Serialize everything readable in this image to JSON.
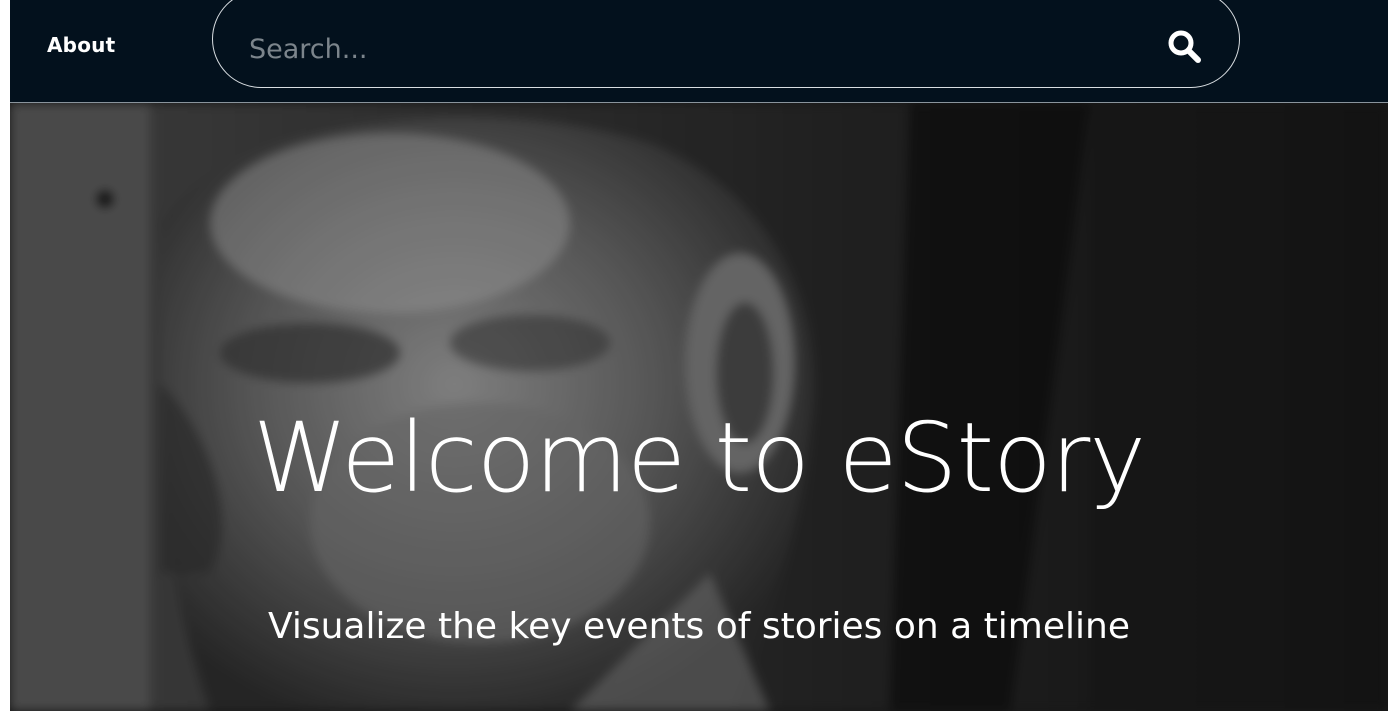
{
  "navbar": {
    "about_label": "About",
    "search": {
      "placeholder": "Search...",
      "value": "",
      "icon": "search-icon"
    }
  },
  "hero": {
    "title": "Welcome to eStory",
    "subtitle": "Visualize the key events of stories on a timeline",
    "background": "black-and-white portrait photograph"
  },
  "colors": {
    "navbar_bg": "#03111d",
    "text": "#ffffff",
    "placeholder": "#7c858c"
  }
}
